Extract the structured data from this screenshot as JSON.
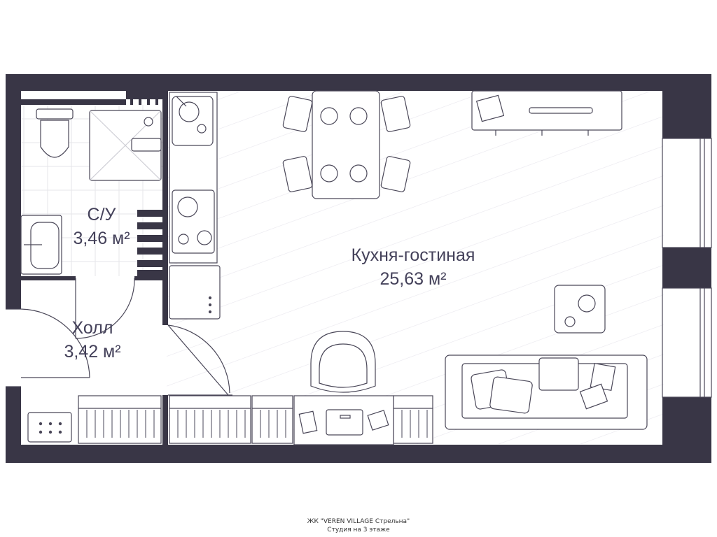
{
  "project": {
    "complex": "ЖК \"VEREN VILLAGE Стрельна\"",
    "floor": "Студия на 3 этаже"
  },
  "rooms": {
    "bathroom": {
      "name": "С/У",
      "area": "3,46 м²"
    },
    "hall": {
      "name": "Холл",
      "area": "3,42 м²"
    },
    "kitchen_living": {
      "name": "Кухня-гостиная",
      "area": "25,63 м²"
    }
  },
  "colors": {
    "wall": "#393646",
    "line": "#4a4758",
    "hatch": "#ecebef",
    "text": "#44415a"
  }
}
